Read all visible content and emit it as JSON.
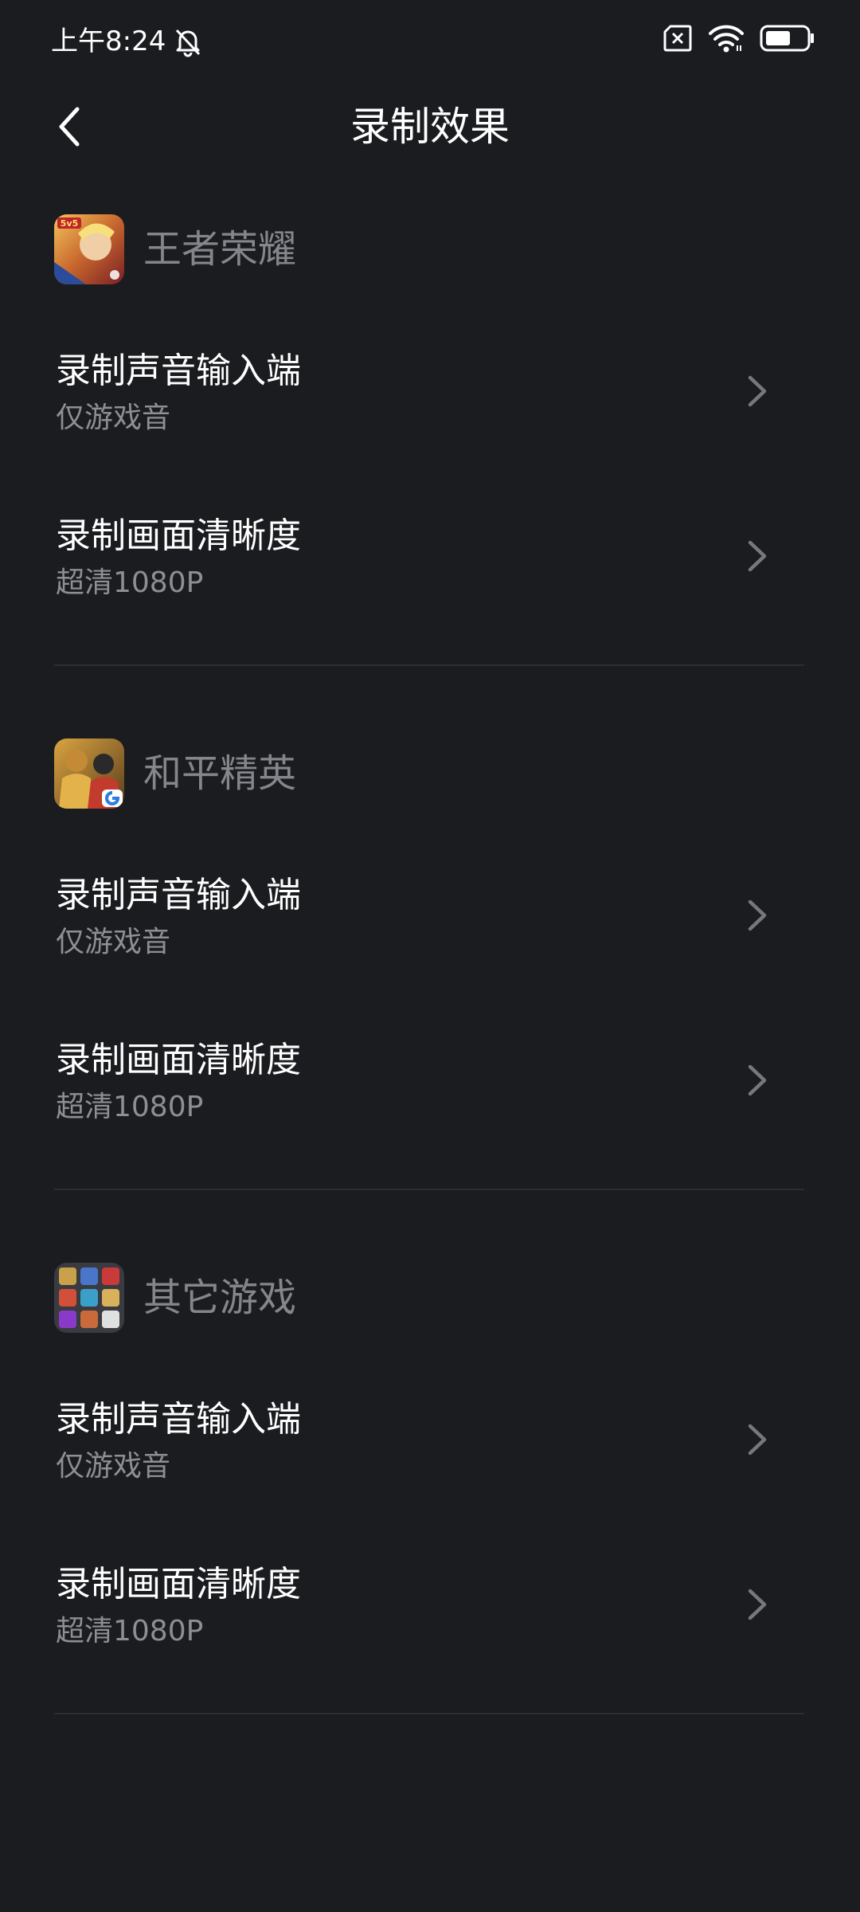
{
  "status": {
    "time": "上午8:24",
    "icons": [
      "bell-off-icon",
      "sim-off-icon",
      "wifi-icon",
      "battery-icon"
    ]
  },
  "header": {
    "title": "录制效果",
    "back_icon": "chevron-left-icon"
  },
  "sections": [
    {
      "name": "王者荣耀",
      "icon": "honor-of-kings-icon",
      "rows": [
        {
          "title": "录制声音输入端",
          "value": "仅游戏音"
        },
        {
          "title": "录制画面清晰度",
          "value": "超清1080P"
        }
      ]
    },
    {
      "name": "和平精英",
      "icon": "peacekeeper-elite-icon",
      "rows": [
        {
          "title": "录制声音输入端",
          "value": "仅游戏音"
        },
        {
          "title": "录制画面清晰度",
          "value": "超清1080P"
        }
      ]
    },
    {
      "name": "其它游戏",
      "icon": "other-games-icon",
      "rows": [
        {
          "title": "录制声音输入端",
          "value": "仅游戏音"
        },
        {
          "title": "录制画面清晰度",
          "value": "超清1080P"
        }
      ]
    }
  ],
  "colors": {
    "background": "#1b1c20",
    "primary_text": "#ffffff",
    "secondary_text": "#8e8f94",
    "divider": "#2c2d31"
  }
}
